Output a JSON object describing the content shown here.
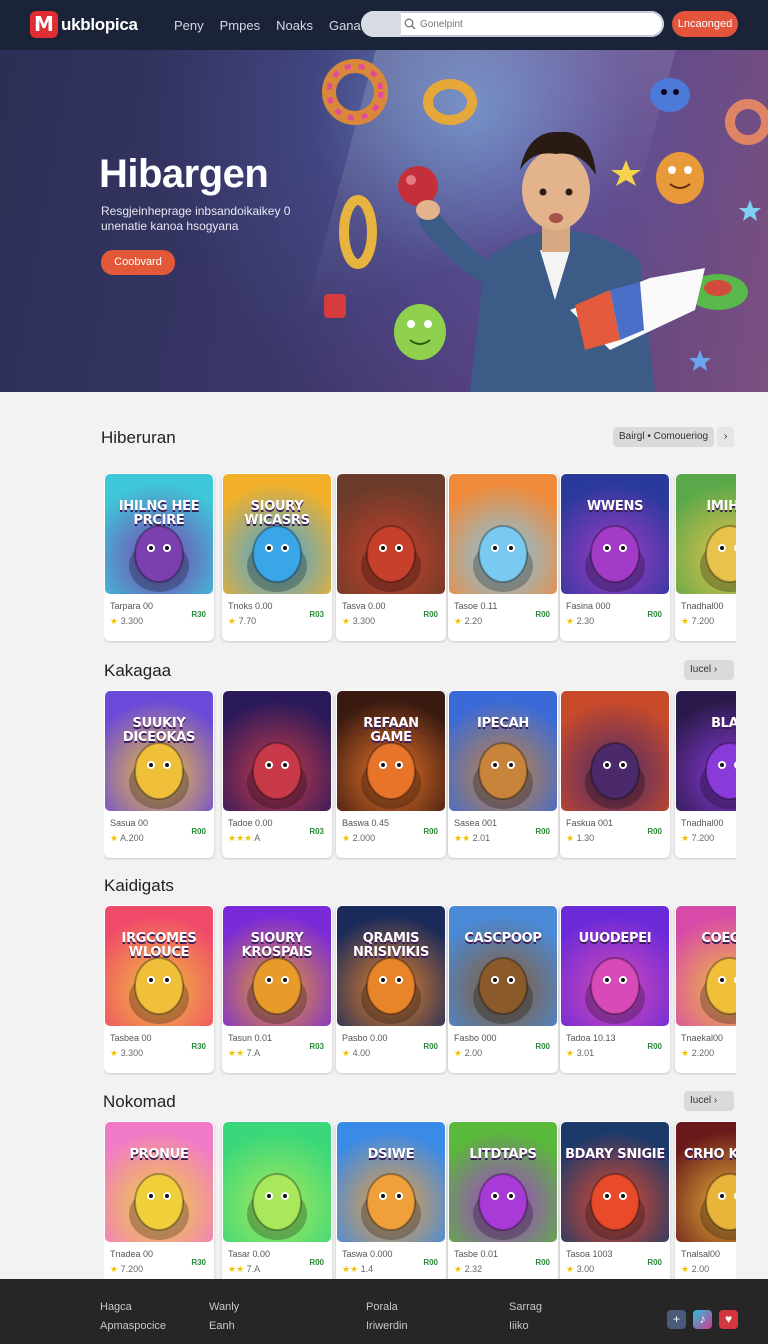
{
  "header": {
    "logo_mark": "M",
    "logo_text": "ukblopica",
    "nav": [
      "Peny",
      "Pmpes",
      "Noaks",
      "Gana"
    ],
    "search_placeholder": "Gonelpint",
    "cta": "Lncaonged"
  },
  "hero": {
    "title": "Hibargen",
    "subtitle": "Resgjeinheprage inbsandoikaikey 0 unenatie kanoa hsogyana",
    "button": "Coobvard"
  },
  "sections": [
    {
      "title": "Hiberuran",
      "control": "Bairgl • Comoueriog",
      "arrow": "›",
      "cards": [
        {
          "art": "IHILNG HEE PRCIRE",
          "name": "Tarpara 00",
          "rating": "★ 3.300",
          "stars_colored": 1,
          "price": "R30"
        },
        {
          "art": "SIOURY WICASRS",
          "name": "Tnoks 0.00",
          "rating": "★ 7.70",
          "stars_colored": 1,
          "price": "R03"
        },
        {
          "art": "",
          "name": "Tasva 0.00",
          "rating": "★ 3.300",
          "stars_colored": 1,
          "price": "R00"
        },
        {
          "art": "",
          "name": "Tasoe 0.11",
          "rating": "★ 2.20",
          "stars_colored": 1,
          "price": "R00"
        },
        {
          "art": "WWENS",
          "name": "Fasina 000",
          "rating": "★ 2.30",
          "stars_colored": 1,
          "price": "R00"
        },
        {
          "art": "IMIHIG",
          "name": "Tnadhal00",
          "rating": "★ 7.200",
          "stars_colored": 1,
          "price": ""
        }
      ]
    },
    {
      "title": "Kakagaa",
      "control": "Iucel",
      "arrow": "›",
      "cards": [
        {
          "art": "SUUKIY DICEOKAS",
          "name": "Sasua 00",
          "rating": "★ A.200",
          "stars_colored": 1,
          "price": "R00"
        },
        {
          "art": "",
          "name": "Tadoe 0.00",
          "rating": "★★★ A",
          "stars_colored": 3,
          "price": "R03"
        },
        {
          "art": "REFAAN GAME",
          "name": "Baswa 0.45",
          "rating": "★ 2.000",
          "stars_colored": 1,
          "price": "R00"
        },
        {
          "art": "IPECAH",
          "name": "Sasea 001",
          "rating": "★★ 2.01",
          "stars_colored": 2,
          "price": "R00"
        },
        {
          "art": "",
          "name": "Faskua 001",
          "rating": "★ 1.30",
          "stars_colored": 1,
          "price": "R00"
        },
        {
          "art": "BLAD",
          "name": "Tnadhal00",
          "rating": "★ 7.200",
          "stars_colored": 1,
          "price": ""
        }
      ]
    },
    {
      "title": "Kaidigats",
      "control": "",
      "arrow": "",
      "cards": [
        {
          "art": "IRGCOMES WLOUCE",
          "name": "Tasbea 00",
          "rating": "★ 3.300",
          "stars_colored": 1,
          "price": "R30"
        },
        {
          "art": "SIOURY KROSPAIS",
          "name": "Tasun 0.01",
          "rating": "★★ 7.A",
          "stars_colored": 2,
          "price": "R03"
        },
        {
          "art": "QRAMIS NRISIVIKIS",
          "name": "Pasbo 0.00",
          "rating": "★ 4.00",
          "stars_colored": 1,
          "price": "R00"
        },
        {
          "art": "CASCPOOP",
          "name": "Fasbo 000",
          "rating": "★ 2.00",
          "stars_colored": 1,
          "price": "R00"
        },
        {
          "art": "UUODEPEI",
          "name": "Tadoa 10.13",
          "rating": "★ 3.01",
          "stars_colored": 1,
          "price": "R00"
        },
        {
          "art": "COECRA",
          "name": "Tnaekal00",
          "rating": "★ 2.200",
          "stars_colored": 1,
          "price": ""
        }
      ]
    },
    {
      "title": "Nokomad",
      "control": "Iucel",
      "arrow": "›",
      "cards": [
        {
          "art": "PRONUE",
          "name": "Tnadea 00",
          "rating": "★ 7.200",
          "stars_colored": 1,
          "price": "R30"
        },
        {
          "art": "",
          "name": "Tasar 0.00",
          "rating": "★★ 7.A",
          "stars_colored": 2,
          "price": "R00"
        },
        {
          "art": "DSIWE",
          "name": "Taswa 0.000",
          "rating": "★★ 1.4",
          "stars_colored": 2,
          "price": "R00"
        },
        {
          "art": "LITDTAPS",
          "name": "Tasbe 0.01",
          "rating": "★ 2.32",
          "stars_colored": 1,
          "price": "R00"
        },
        {
          "art": "BDARY SNIGIE",
          "name": "Tasoa 1003",
          "rating": "★ 3.00",
          "stars_colored": 1,
          "price": "R00"
        },
        {
          "art": "CRHO KLODS",
          "name": "Tnalsal00",
          "rating": "★ 2.00",
          "stars_colored": 1,
          "price": ""
        }
      ]
    }
  ],
  "footer": {
    "columns": [
      [
        "Hagca",
        "Apmaspocice"
      ],
      [
        "Wanly",
        "Eanh"
      ],
      [
        "Porala",
        "Iriwerdin"
      ],
      [
        "Sarrag",
        "Iiiko"
      ]
    ],
    "social": [
      "+",
      "♪",
      "♥"
    ]
  },
  "colors": {
    "nav_bg": "#1a2338",
    "accent": "#e4533b",
    "logo_red": "#e02c33",
    "footer_bg": "#262626",
    "price_green": "#2a8b3a",
    "star": "#f2c200"
  }
}
